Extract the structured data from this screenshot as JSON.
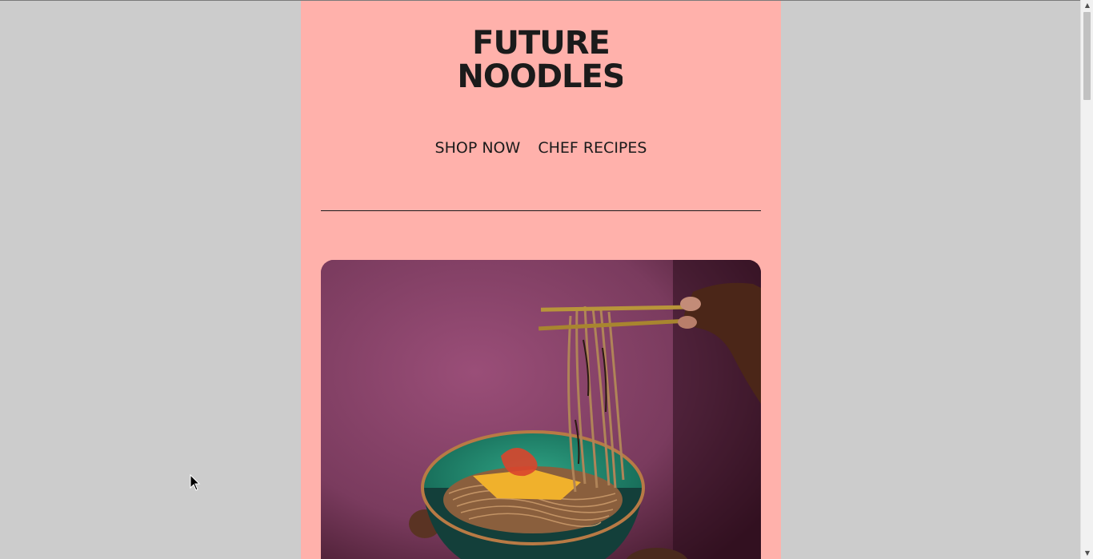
{
  "brand": {
    "logo_line1": "FUTURE",
    "logo_line2": "NOODLES",
    "logo_icon": "infinity-noodle-icon",
    "background": "#ffb1ab",
    "text_color": "#1b1b1b"
  },
  "nav": {
    "items": [
      {
        "label": "SHOP NOW"
      },
      {
        "label": "CHEF RECIPES"
      }
    ]
  },
  "hero": {
    "image": "noodle-bowl-with-chopsticks-image",
    "colors": {
      "backdrop": "#7a3b5e",
      "bowl": "#1f8a70",
      "noodles": "#a47a52"
    }
  },
  "browser": {
    "page_background": "#cccccc",
    "scrollbar": {
      "up_icon": "scroll-up-arrow-icon",
      "down_icon": "scroll-down-arrow-icon"
    },
    "cursor_icon": "mouse-pointer-icon"
  }
}
